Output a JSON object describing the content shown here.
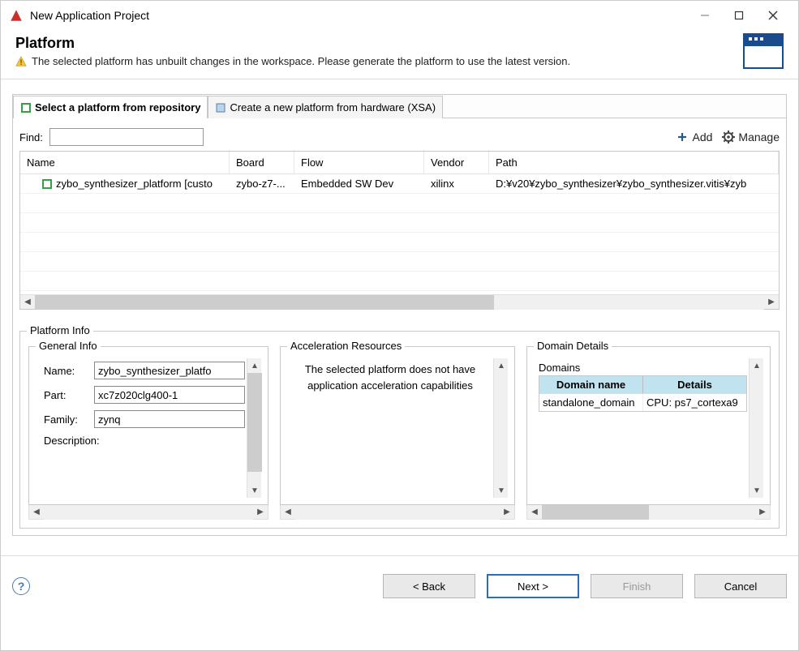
{
  "window": {
    "title": "New Application Project"
  },
  "header": {
    "title": "Platform",
    "warning": "The selected platform has unbuilt changes in the workspace. Please generate the platform to use the latest version."
  },
  "tabs": {
    "repo": "Select a platform from repository",
    "xsa": "Create a new platform from hardware (XSA)"
  },
  "find": {
    "label": "Find:",
    "value": ""
  },
  "actions": {
    "add": "Add",
    "manage": "Manage"
  },
  "table": {
    "columns": {
      "name": "Name",
      "board": "Board",
      "flow": "Flow",
      "vendor": "Vendor",
      "path": "Path"
    },
    "rows": [
      {
        "name": "zybo_synthesizer_platform [custo",
        "board": "zybo-z7-...",
        "flow": "Embedded SW Dev",
        "vendor": "xilinx",
        "path": "D:¥v20¥zybo_synthesizer¥zybo_synthesizer.vitis¥zyb"
      }
    ]
  },
  "platform_info": {
    "legend": "Platform Info",
    "general": {
      "legend": "General Info",
      "name_label": "Name:",
      "name_value": "zybo_synthesizer_platfo",
      "part_label": "Part:",
      "part_value": "xc7z020clg400-1",
      "family_label": "Family:",
      "family_value": "zynq",
      "description_label": "Description:"
    },
    "accel": {
      "legend": "Acceleration Resources",
      "text1": "The selected platform does not have",
      "text2": "application acceleration capabilities"
    },
    "domain": {
      "legend": "Domain Details",
      "label": "Domains",
      "columns": {
        "name": "Domain name",
        "details": "Details"
      },
      "rows": [
        {
          "name": "standalone_domain",
          "details": "CPU: ps7_cortexa9"
        }
      ]
    }
  },
  "footer": {
    "back": "< Back",
    "next": "Next >",
    "finish": "Finish",
    "cancel": "Cancel"
  }
}
